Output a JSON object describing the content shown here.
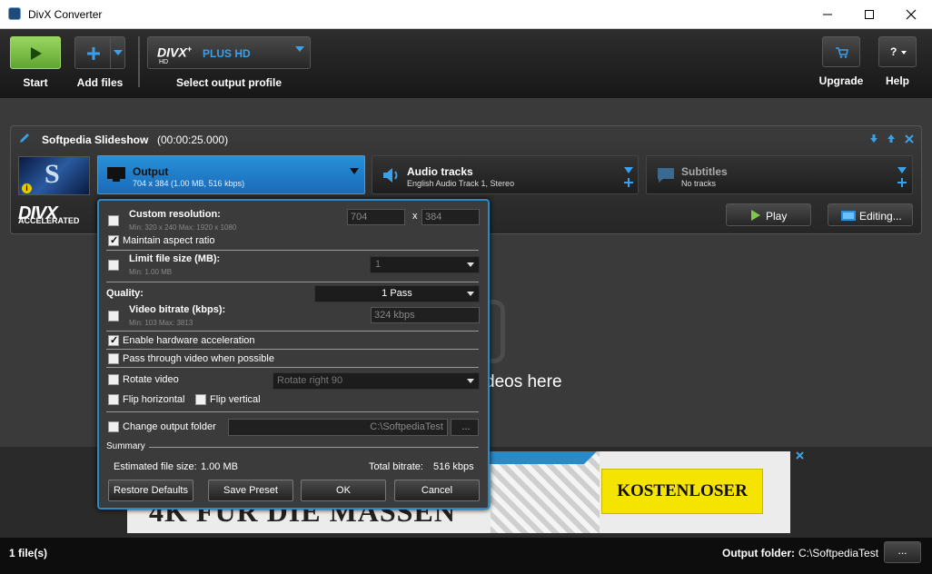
{
  "window": {
    "title": "DivX Converter"
  },
  "toolbar": {
    "start": "Start",
    "add_files": "Add files",
    "profile_name": "PLUS HD",
    "select_profile": "Select output profile",
    "upgrade": "Upgrade",
    "help": "Help",
    "help_icon": "?"
  },
  "job": {
    "title": "Softpedia Slideshow",
    "duration": "(00:00:25.000)",
    "output_label": "Output",
    "output_detail": "704 x 384 (1.00 MB, 516 kbps)",
    "audio_label": "Audio tracks",
    "audio_detail": "English Audio Track 1, Stereo",
    "subs_label": "Subtitles",
    "subs_detail": "No tracks",
    "play": "Play",
    "editing": "Editing...",
    "accelerated": "ACCELERATED"
  },
  "dialog": {
    "custom_resolution": "Custom resolution:",
    "res_hint": "Min: 320 x 240   Max: 1920 x 1080",
    "width": "704",
    "height": "384",
    "x": "x",
    "maintain_aspect": "Maintain aspect ratio",
    "limit_size": "Limit file size (MB):",
    "size_hint": "Min: 1.00 MB",
    "size_value": "1",
    "quality_label": "Quality:",
    "quality_value": "1 Pass",
    "video_bitrate": "Video bitrate (kbps):",
    "bitrate_hint": "Min: 103   Max: 3813",
    "bitrate_value": "324 kbps",
    "hw_accel": "Enable hardware acceleration",
    "pass_through": "Pass through video when possible",
    "rotate": "Rotate video",
    "rotate_value": "Rotate right 90",
    "flip_h": "Flip horizontal",
    "flip_v": "Flip vertical",
    "change_folder": "Change output folder",
    "folder_value": "C:\\SoftpediaTest",
    "browse": "...",
    "summary": "Summary",
    "est_size_label": "Estimated file size:",
    "est_size": "1.00 MB",
    "total_bitrate_label": "Total bitrate:",
    "total_bitrate": "516 kbps",
    "restore": "Restore Defaults",
    "save_preset": "Save Preset",
    "ok": "OK",
    "cancel": "Cancel"
  },
  "background": {
    "drop_text": "deos here"
  },
  "ad": {
    "headline": "4K FÜR DIE MASSEN",
    "cta": "KOSTENLOSER"
  },
  "status": {
    "files": "1 file(s)",
    "output_folder_label": "Output folder:",
    "output_folder": "C:\\SoftpediaTest",
    "browse": "..."
  },
  "colors": {
    "accent": "#2b8ac6",
    "start_green": "#7ec84a",
    "ad_yellow": "#f5e400"
  }
}
